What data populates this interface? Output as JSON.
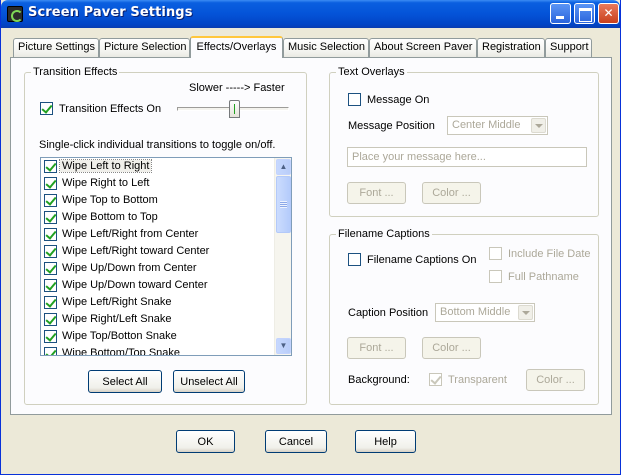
{
  "window": {
    "title": "Screen Paver Settings",
    "controls": {
      "minimize": "",
      "maximize": "",
      "close": "✕"
    }
  },
  "tabs": [
    {
      "label": "Picture Settings",
      "active": false
    },
    {
      "label": "Picture Selection",
      "active": false
    },
    {
      "label": "Effects/Overlays",
      "active": true
    },
    {
      "label": "Music Selection",
      "active": false
    },
    {
      "label": "About Screen Paver",
      "active": false
    },
    {
      "label": "Registration",
      "active": false
    },
    {
      "label": "Support",
      "active": false
    }
  ],
  "transition_effects": {
    "group_label": "Transition Effects",
    "enabled_label": "Transition Effects On",
    "enabled": true,
    "speed_label": "Slower -----> Faster",
    "speed_level": 0.5,
    "instructions": "Single-click individual transitions to toggle on/off.",
    "items": [
      {
        "label": "Wipe Left to Right",
        "checked": true,
        "selected": true
      },
      {
        "label": "Wipe Right to Left",
        "checked": true
      },
      {
        "label": "Wipe Top to Bottom",
        "checked": true
      },
      {
        "label": "Wipe Bottom to Top",
        "checked": true
      },
      {
        "label": "Wipe Left/Right from Center",
        "checked": true
      },
      {
        "label": "Wipe Left/Right toward Center",
        "checked": true
      },
      {
        "label": "Wipe Up/Down from Center",
        "checked": true
      },
      {
        "label": "Wipe Up/Down toward Center",
        "checked": true
      },
      {
        "label": "Wipe Left/Right Snake",
        "checked": true
      },
      {
        "label": "Wipe Right/Left Snake",
        "checked": true
      },
      {
        "label": "Wipe Top/Botton Snake",
        "checked": true
      },
      {
        "label": "Wipe Bottom/Top Snake",
        "checked": true
      }
    ],
    "select_all_label": "Select All",
    "unselect_all_label": "Unselect All"
  },
  "text_overlays": {
    "group_label": "Text Overlays",
    "message_on_label": "Message On",
    "message_on": false,
    "position_label": "Message Position",
    "position_value": "Center Middle",
    "message_placeholder": "Place your message here...",
    "font_label": "Font ...",
    "color_label": "Color ..."
  },
  "filename_captions": {
    "group_label": "Filename Captions",
    "captions_on_label": "Filename Captions On",
    "captions_on": false,
    "include_date_label": "Include File Date",
    "full_path_label": "Full Pathname",
    "position_label": "Caption Position",
    "position_value": "Bottom Middle",
    "font_label": "Font ...",
    "color_label": "Color ...",
    "background_label": "Background:",
    "transparent_label": "Transparent",
    "transparent": true,
    "bg_color_label": "Color ..."
  },
  "footer": {
    "ok_label": "OK",
    "cancel_label": "Cancel",
    "help_label": "Help"
  },
  "colors": {
    "title_blue": "#0453d8",
    "dialog_face": "#ece9d8",
    "check_green": "#21a121",
    "disabled_text": "#aca899"
  }
}
